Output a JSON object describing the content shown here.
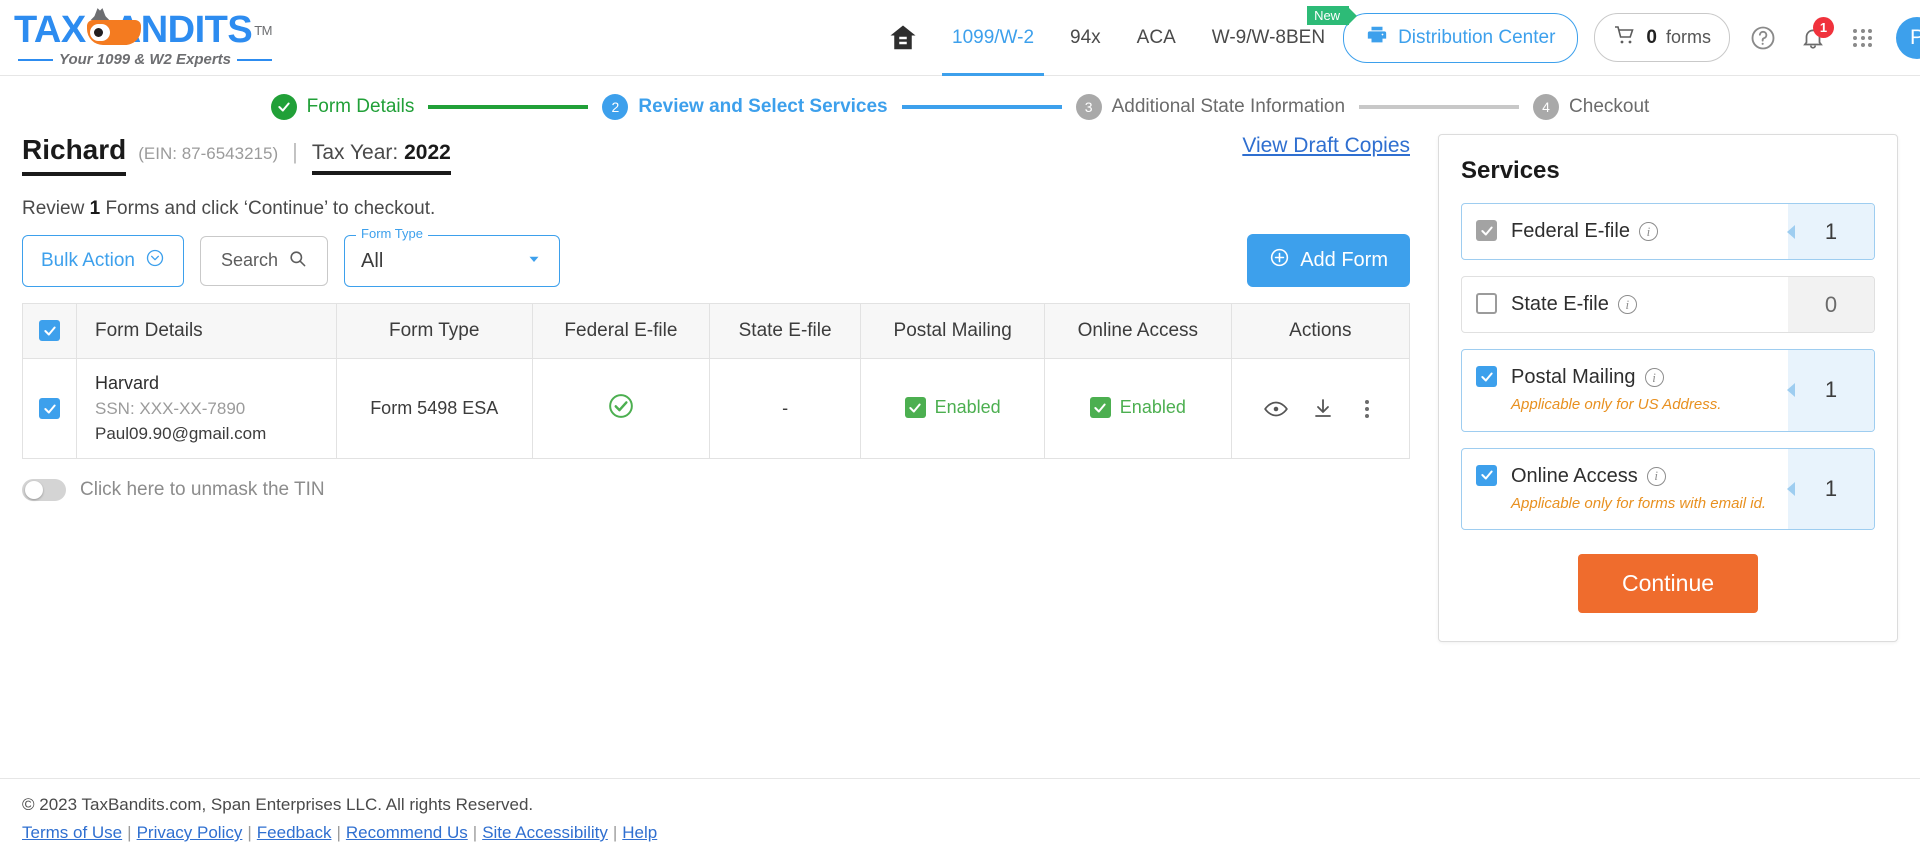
{
  "header": {
    "logo_text_1": "TAX",
    "logo_text_2": "ANDITS",
    "logo_tm": "TM",
    "logo_tagline": "Your 1099 & W2 Experts",
    "nav": [
      {
        "label": "1099/W-2",
        "active": true,
        "badge": null
      },
      {
        "label": "94x",
        "active": false,
        "badge": null
      },
      {
        "label": "ACA",
        "active": false,
        "badge": null
      },
      {
        "label": "W-9/W-8BEN",
        "active": false,
        "badge": "New"
      }
    ],
    "distribution_center": "Distribution Center",
    "cart_count": "0",
    "cart_label": "forms",
    "notification_count": "1",
    "avatar_initial": "P"
  },
  "stepper": {
    "steps": [
      {
        "num": "1",
        "label": "Form Details",
        "state": "done"
      },
      {
        "num": "2",
        "label": "Review and Select Services",
        "state": "current"
      },
      {
        "num": "3",
        "label": "Additional State Information",
        "state": "todo"
      },
      {
        "num": "4",
        "label": "Checkout",
        "state": "todo"
      }
    ]
  },
  "page": {
    "business_name": "Richard",
    "ein": "(EIN: 87-6543215)",
    "separator": "|",
    "tax_year_label": "Tax Year:",
    "tax_year_value": "2022",
    "view_draft_copies": "View Draft Copies",
    "review_prefix": "Review",
    "review_count": "1",
    "review_suffix": "Forms and click ‘Continue’ to checkout."
  },
  "toolbar": {
    "bulk_action": "Bulk Action",
    "search": "Search",
    "form_type_label": "Form Type",
    "form_type_value": "All",
    "add_form": "Add Form"
  },
  "table": {
    "columns": [
      "Form Details",
      "Form Type",
      "Federal E-file",
      "State E-file",
      "Postal Mailing",
      "Online Access",
      "Actions"
    ],
    "rows": [
      {
        "selected": true,
        "name": "Harvard",
        "ssn": "SSN: XXX-XX-7890",
        "email": "Paul09.90@gmail.com",
        "form_type": "Form 5498 ESA",
        "federal_efile": "check",
        "state_efile": "-",
        "postal_mailing": "Enabled",
        "online_access": "Enabled"
      }
    ]
  },
  "mask_toggle": {
    "label": "Click here to unmask the TIN",
    "on": false
  },
  "services": {
    "title": "Services",
    "items": [
      {
        "label": "Federal E-file",
        "checkbox": "checked-grey",
        "note": null,
        "count": "1",
        "count_state": "filled",
        "active": true
      },
      {
        "label": "State E-file",
        "checkbox": "unchecked",
        "note": null,
        "count": "0",
        "count_state": "empty",
        "active": false
      },
      {
        "label": "Postal Mailing",
        "checkbox": "checked-blue",
        "note": "Applicable only for US Address.",
        "count": "1",
        "count_state": "filled",
        "active": true
      },
      {
        "label": "Online Access",
        "checkbox": "checked-blue",
        "note": "Applicable only for forms with email id.",
        "count": "1",
        "count_state": "filled",
        "active": true
      }
    ],
    "continue_label": "Continue"
  },
  "footer": {
    "copyright": "© 2023 TaxBandits.com, Span Enterprises LLC. All rights Reserved.",
    "links": [
      "Terms of Use",
      "Privacy Policy",
      "Feedback",
      "Recommend Us",
      "Site Accessibility",
      "Help"
    ]
  },
  "colors": {
    "brand_blue": "#3da0ec",
    "brand_orange": "#f47b20",
    "green": "#21a038",
    "continue_orange": "#ef6c2d",
    "badge_red": "#f0323c",
    "new_green": "#2dbb77"
  }
}
